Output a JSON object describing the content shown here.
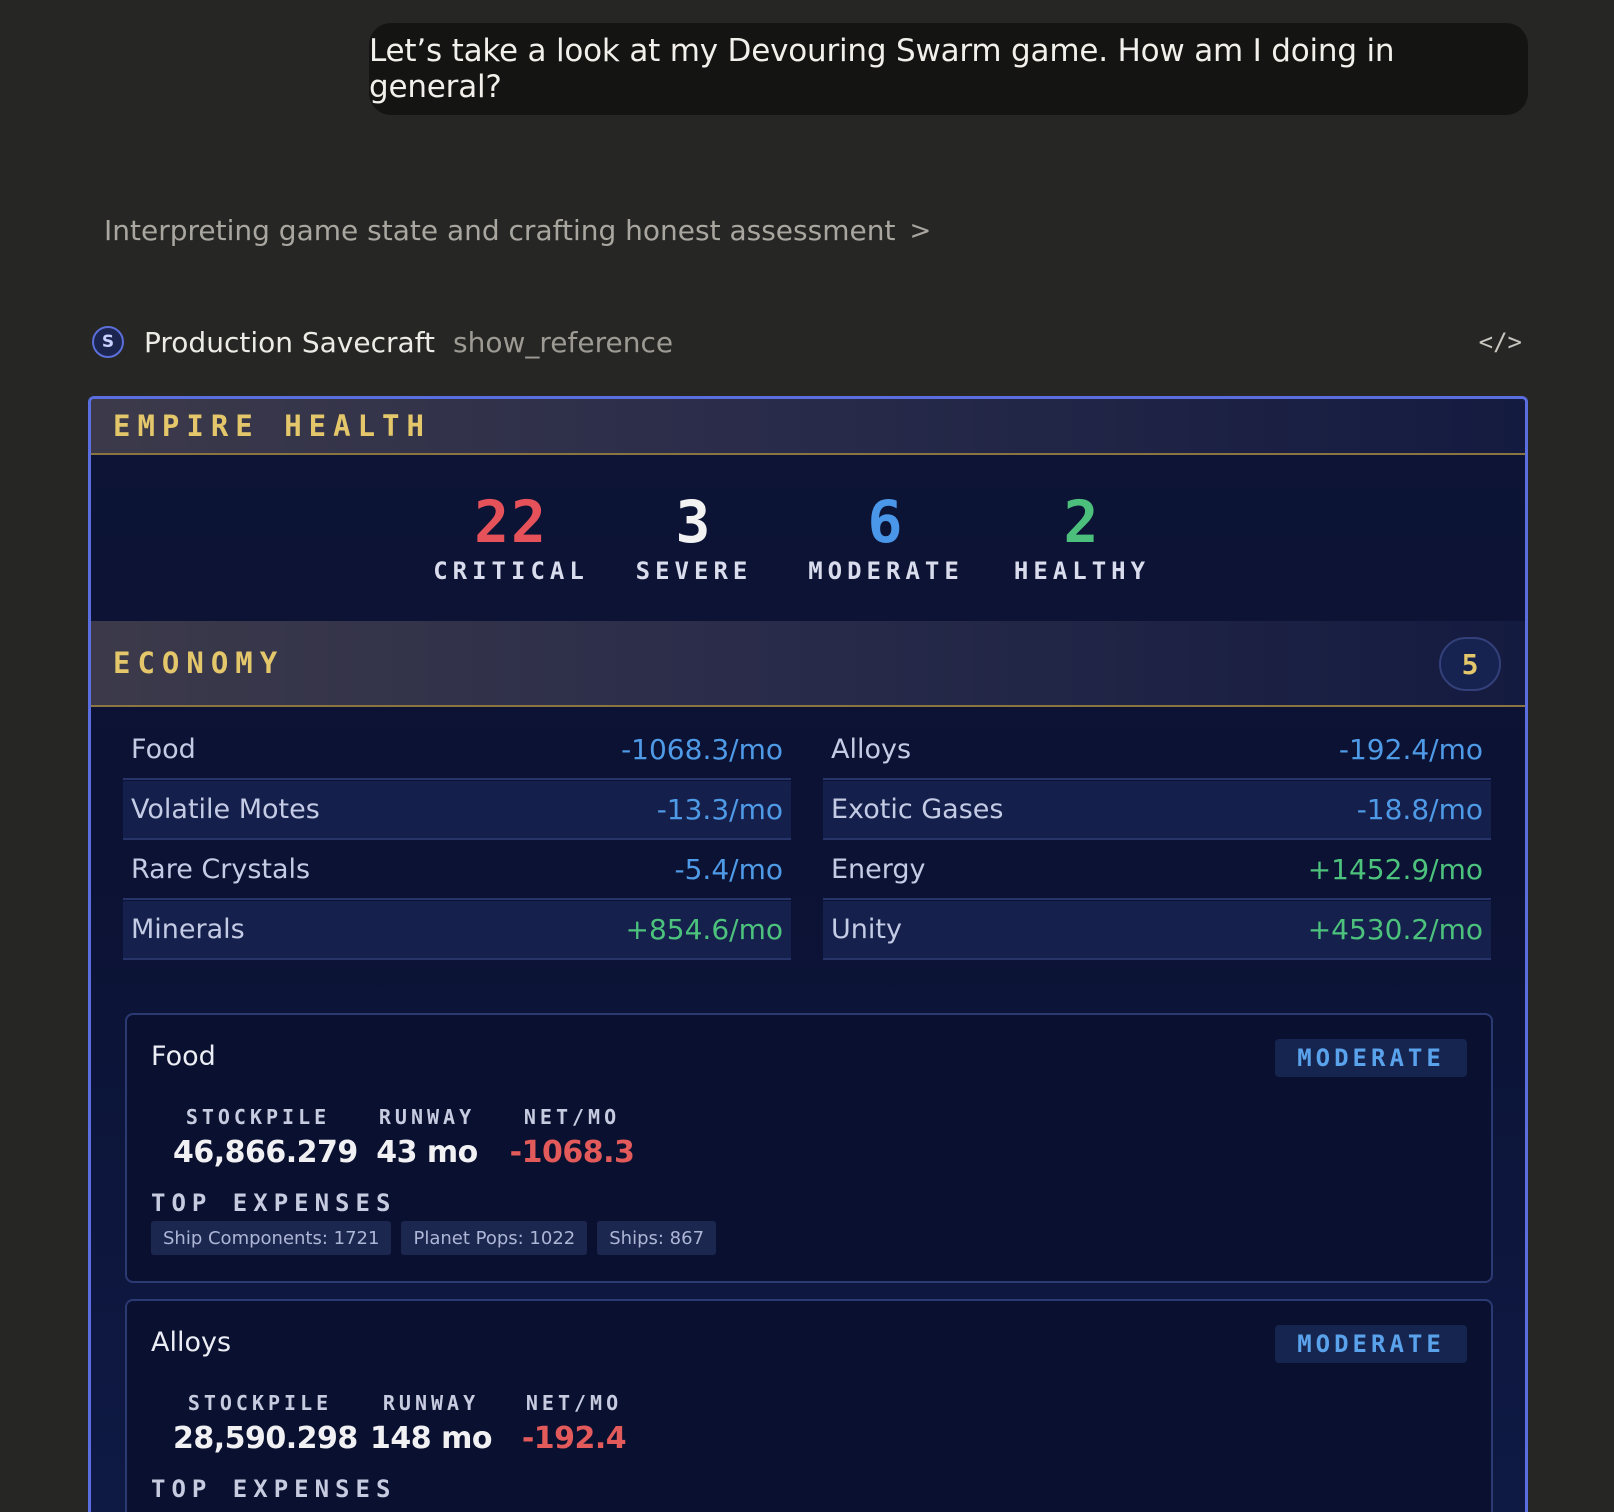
{
  "user_message": "Let’s take a look at my Devouring Swarm game. How am I doing in general?",
  "thinking": {
    "label": "Interpreting game state and crafting honest assessment",
    "chevron": ">"
  },
  "tool": {
    "icon_letter": "S",
    "name": "Production Savecraft",
    "command": "show_reference",
    "code_icon": "</>"
  },
  "empire_health": {
    "title": "EMPIRE HEALTH",
    "stats": [
      {
        "value": "22",
        "label": "CRITICAL",
        "color": "#e5525a"
      },
      {
        "value": "3",
        "label": "SEVERE",
        "color": "#f2f2f2"
      },
      {
        "value": "6",
        "label": "MODERATE",
        "color": "#4a97ea"
      },
      {
        "value": "2",
        "label": "HEALTHY",
        "color": "#4cbf7c"
      }
    ]
  },
  "economy": {
    "title": "ECONOMY",
    "count": "5",
    "resources_left": [
      {
        "name": "Food",
        "value": "-1068.3/mo",
        "sign": "neg"
      },
      {
        "name": "Volatile Motes",
        "value": "-13.3/mo",
        "sign": "neg"
      },
      {
        "name": "Rare Crystals",
        "value": "-5.4/mo",
        "sign": "neg"
      },
      {
        "name": "Minerals",
        "value": "+854.6/mo",
        "sign": "pos"
      }
    ],
    "resources_right": [
      {
        "name": "Alloys",
        "value": "-192.4/mo",
        "sign": "neg"
      },
      {
        "name": "Exotic Gases",
        "value": "-18.8/mo",
        "sign": "neg"
      },
      {
        "name": "Energy",
        "value": "+1452.9/mo",
        "sign": "pos"
      },
      {
        "name": "Unity",
        "value": "+4530.2/mo",
        "sign": "pos"
      }
    ],
    "cards": [
      {
        "title": "Food",
        "status": "MODERATE",
        "stockpile_label": "STOCKPILE",
        "stockpile": "46,866.279",
        "runway_label": "RUNWAY",
        "runway": "43 mo",
        "net_label": "NET/MO",
        "net": "-1068.3",
        "top_expenses_label": "TOP EXPENSES",
        "expenses": [
          "Ship Components: 1721",
          "Planet Pops: 1022",
          "Ships: 867"
        ]
      },
      {
        "title": "Alloys",
        "status": "MODERATE",
        "stockpile_label": "STOCKPILE",
        "stockpile": "28,590.298",
        "runway_label": "RUNWAY",
        "runway": "148 mo",
        "net_label": "NET/MO",
        "net": "-192.4",
        "top_expenses_label": "TOP EXPENSES",
        "expenses": []
      }
    ]
  }
}
